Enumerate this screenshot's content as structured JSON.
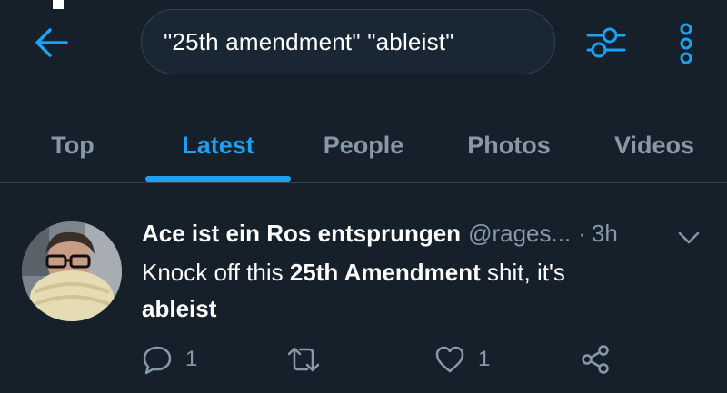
{
  "search": {
    "query": "\"25th amendment\" \"ableist\""
  },
  "tabs": [
    {
      "label": "Top"
    },
    {
      "label": "Latest"
    },
    {
      "label": "People"
    },
    {
      "label": "Photos"
    },
    {
      "label": "Videos"
    }
  ],
  "active_tab": "Latest",
  "tweet": {
    "display_name": "Ace ist ein Ros entsprungen",
    "handle": "@rages...",
    "separator": "·",
    "time": "3h",
    "text_1": "Knock off this ",
    "text_bold_1": "25th Amendment",
    "text_2": " shit, it's",
    "text_bold_2": "ableist",
    "reply_count": "1",
    "like_count": "1"
  },
  "icons": {
    "back": "arrow-left-icon",
    "filter": "sliders-icon",
    "more": "more-vertical-icon",
    "caret": "chevron-down-icon",
    "reply": "reply-icon",
    "retweet": "retweet-icon",
    "like": "heart-icon",
    "share": "share-icon"
  },
  "colors": {
    "background": "#15202b",
    "accent": "#1da1f2",
    "secondary_text": "#8899a6",
    "divider": "#38444d"
  }
}
